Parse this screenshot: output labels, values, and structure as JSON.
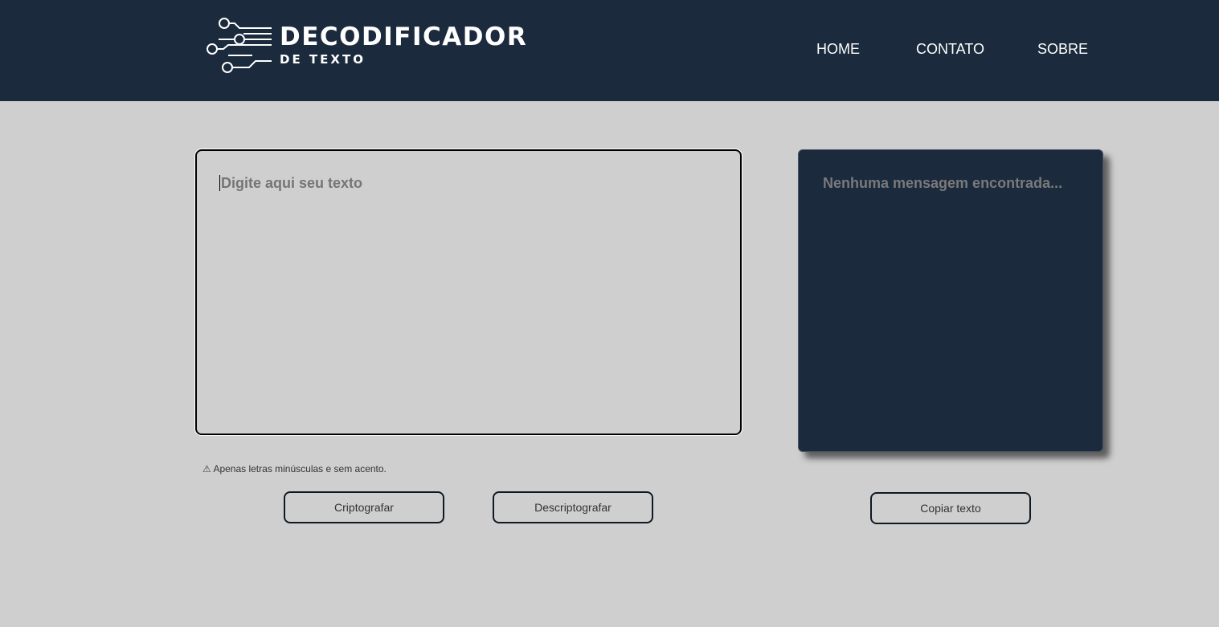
{
  "header": {
    "logo_title": "DECODIFICADOR",
    "logo_subtitle": "DE TEXTO",
    "nav": {
      "home": "HOME",
      "contato": "CONTATO",
      "sobre": "SOBRE"
    }
  },
  "input": {
    "placeholder": "Digite aqui seu texto",
    "value": ""
  },
  "output": {
    "message": "Nenhuma mensagem encontrada..."
  },
  "warning": {
    "icon": "⚠",
    "text": "Apenas letras minúsculas e sem acento."
  },
  "buttons": {
    "encrypt": "Criptografar",
    "decrypt": "Descriptografar",
    "copy": "Copiar texto"
  },
  "colors": {
    "header_bg": "#1b2a3c",
    "page_bg": "#cfcfcf",
    "output_bg": "#1b2a3c"
  }
}
